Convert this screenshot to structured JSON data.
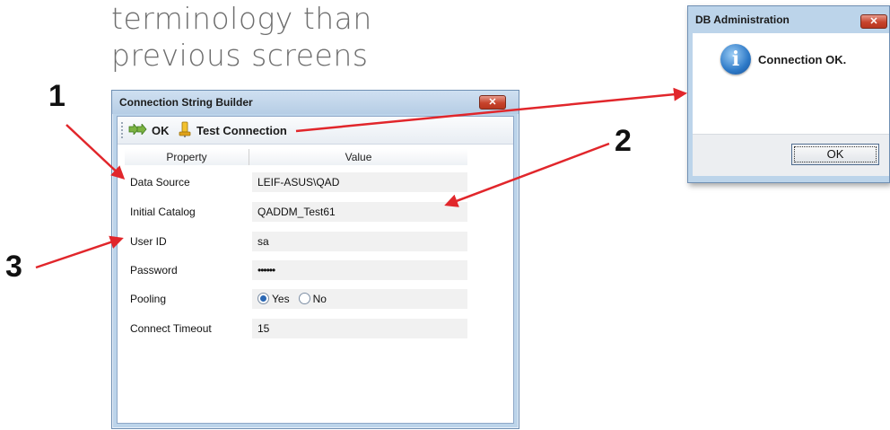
{
  "slide": {
    "heading_line1": "terminology than",
    "heading_line2": "previous screens",
    "callouts": [
      "1",
      "2",
      "3"
    ],
    "arrow_color": "#e1262b"
  },
  "builder_window": {
    "title": "Connection String Builder",
    "close_glyph": "✕",
    "toolbar": {
      "ok_label": "OK",
      "ok_icon": "double-arrow-right-icon",
      "test_label": "Test Connection",
      "test_icon": "database-plug-icon"
    },
    "grid": {
      "headers": [
        "Property",
        "Value"
      ],
      "rows": [
        {
          "property": "Data Source",
          "value": "LEIF-ASUS\\QAD"
        },
        {
          "property": "Initial Catalog",
          "value": "QADDM_Test61"
        },
        {
          "property": "User ID",
          "value": "sa"
        },
        {
          "property": "Password",
          "value": "••••••"
        },
        {
          "property": "Pooling",
          "options": [
            "Yes",
            "No"
          ],
          "selected": "Yes"
        },
        {
          "property": "Connect Timeout",
          "value": "15"
        }
      ]
    }
  },
  "dialog": {
    "title": "DB Administration",
    "close_glyph": "✕",
    "icon": "info-icon",
    "icon_glyph": "i",
    "message": "Connection OK.",
    "ok_label": "OK"
  }
}
